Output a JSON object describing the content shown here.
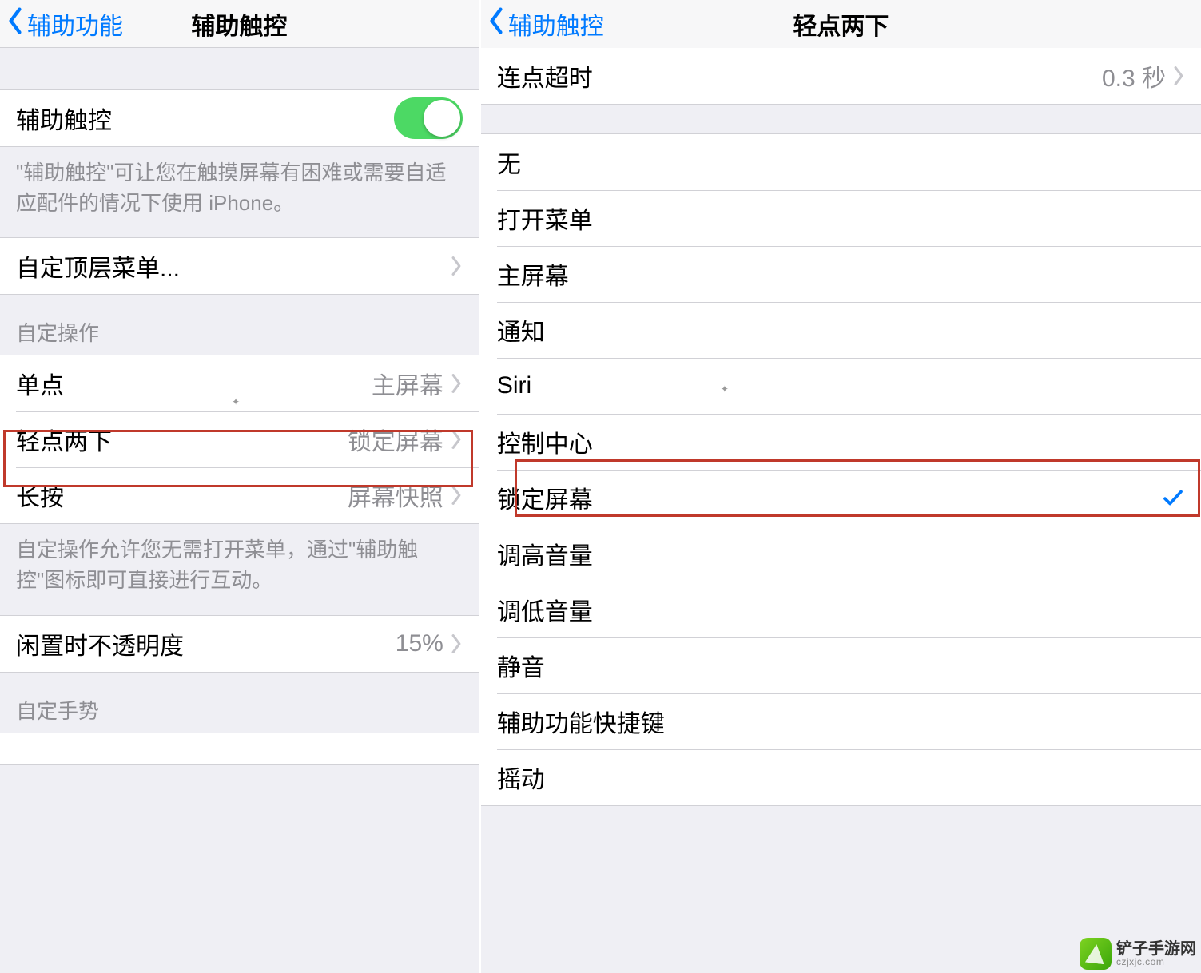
{
  "left": {
    "nav": {
      "back": "辅助功能",
      "title": "辅助触控"
    },
    "toggle_row": {
      "label": "辅助触控",
      "on": true
    },
    "toggle_footer": "\"辅助触控\"可让您在触摸屏幕有困难或需要自适应配件的情况下使用 iPhone。",
    "customize_menu": {
      "label": "自定顶层菜单..."
    },
    "custom_actions_header": "自定操作",
    "actions": [
      {
        "label": "单点",
        "value": "主屏幕"
      },
      {
        "label": "轻点两下",
        "value": "锁定屏幕"
      },
      {
        "label": "长按",
        "value": "屏幕快照"
      }
    ],
    "actions_footer": "自定操作允许您无需打开菜单，通过\"辅助触控\"图标即可直接进行互动。",
    "idle_opacity": {
      "label": "闲置时不透明度",
      "value": "15%"
    },
    "gestures_header": "自定手势"
  },
  "right": {
    "nav": {
      "back": "辅助触控",
      "title": "轻点两下"
    },
    "timeout": {
      "label": "连点超时",
      "value": "0.3 秒"
    },
    "options": [
      {
        "label": "无",
        "selected": false
      },
      {
        "label": "打开菜单",
        "selected": false
      },
      {
        "label": "主屏幕",
        "selected": false
      },
      {
        "label": "通知",
        "selected": false
      },
      {
        "label": "Siri",
        "selected": false
      },
      {
        "label": "控制中心",
        "selected": false
      },
      {
        "label": "锁定屏幕",
        "selected": true
      },
      {
        "label": "调高音量",
        "selected": false
      },
      {
        "label": "调低音量",
        "selected": false
      },
      {
        "label": "静音",
        "selected": false
      },
      {
        "label": "辅助功能快捷键",
        "selected": false
      },
      {
        "label": "摇动",
        "selected": false
      }
    ]
  },
  "watermark": {
    "name": "铲子手游网",
    "url": "czjxjc.com"
  }
}
